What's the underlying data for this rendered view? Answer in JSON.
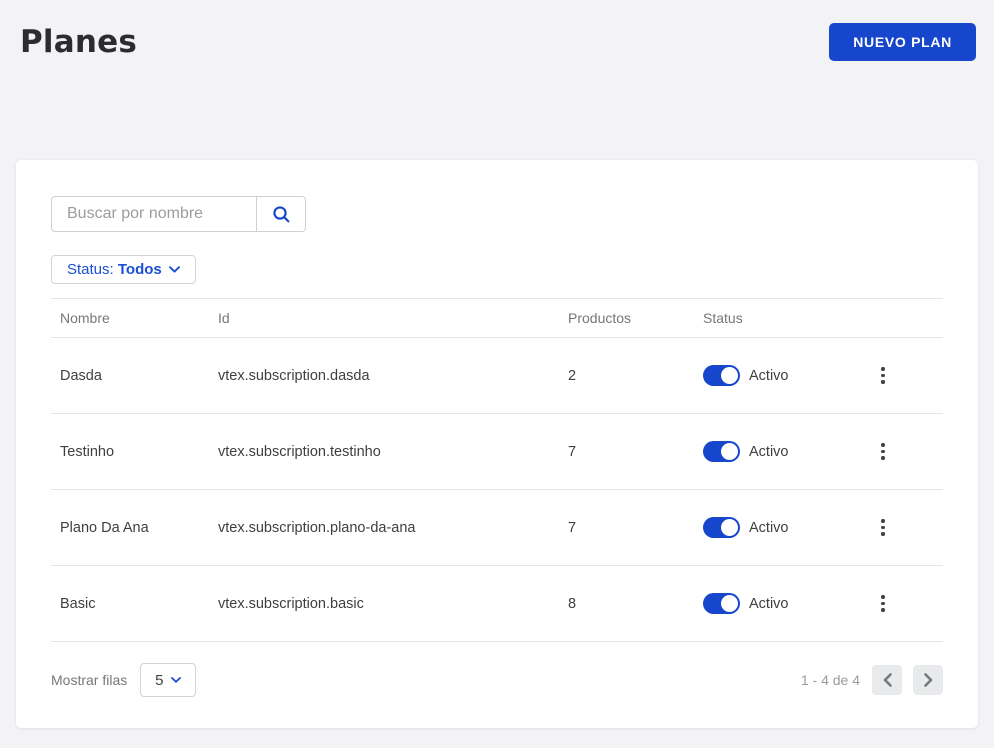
{
  "page": {
    "title": "Planes"
  },
  "header": {
    "new_plan_button": "NUEVO PLAN"
  },
  "colors": {
    "primary_blue": "#1546cb",
    "background": "#f3f3f5",
    "text_dark": "#3f3f40",
    "text_muted": "#76777a"
  },
  "search": {
    "placeholder": "Buscar por nombre",
    "value": "",
    "icon": "search-icon"
  },
  "filters": {
    "status_label": "Status:",
    "status_value": "Todos"
  },
  "table": {
    "columns": [
      "Nombre",
      "Id",
      "Productos",
      "Status"
    ],
    "rows": [
      {
        "nombre": "Dasda",
        "id": "vtex.subscription.dasda",
        "productos": "2",
        "status": "Activo",
        "active": true
      },
      {
        "nombre": "Testinho",
        "id": "vtex.subscription.testinho",
        "productos": "7",
        "status": "Activo",
        "active": true
      },
      {
        "nombre": "Plano Da Ana",
        "id": "vtex.subscription.plano-da-ana",
        "productos": "7",
        "status": "Activo",
        "active": true
      },
      {
        "nombre": "Basic",
        "id": "vtex.subscription.basic",
        "productos": "8",
        "status": "Activo",
        "active": true
      }
    ]
  },
  "footer": {
    "rows_label": "Mostrar filas",
    "rows_value": "5",
    "range": "1 - 4 de 4"
  }
}
